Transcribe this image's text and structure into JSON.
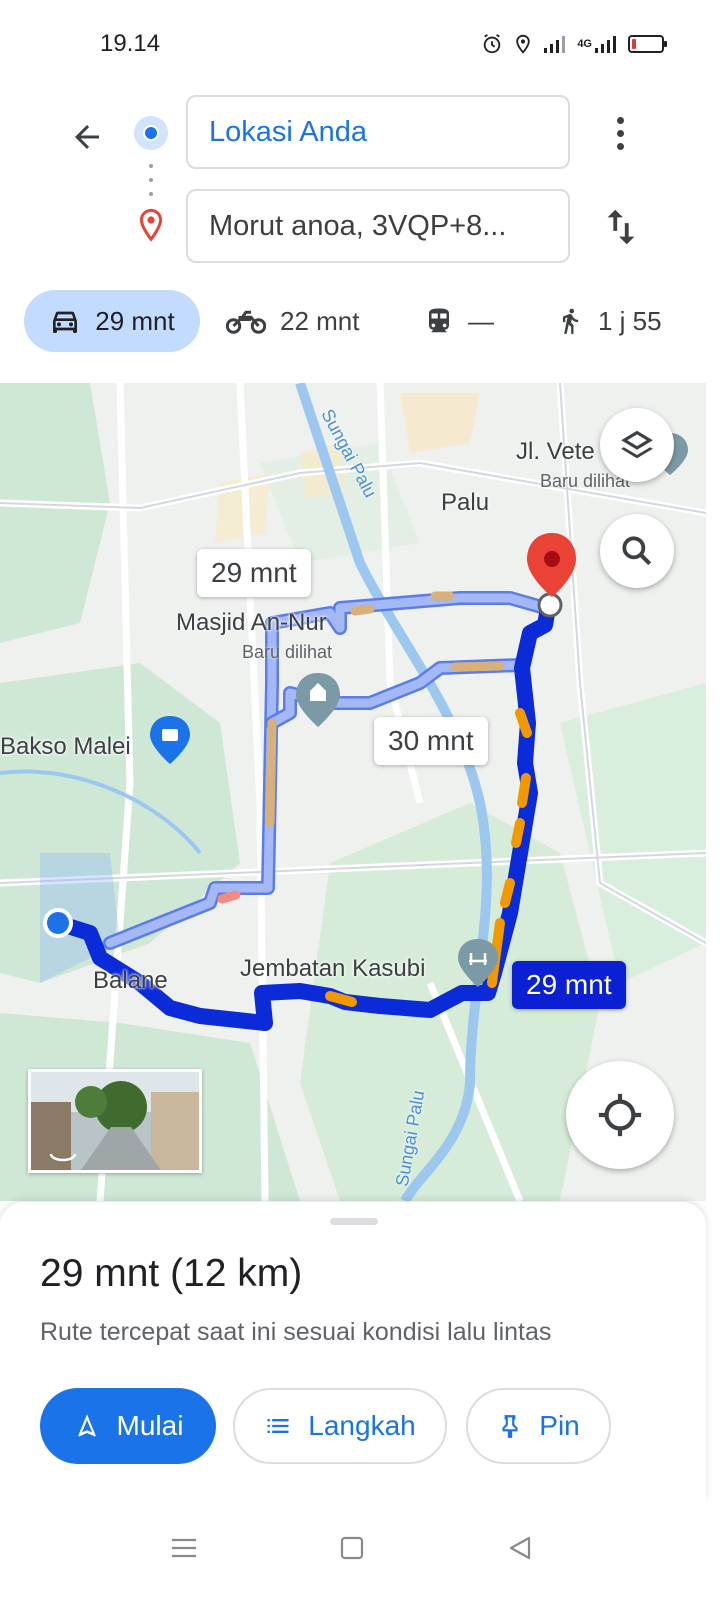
{
  "status_bar": {
    "time": "19.14",
    "network": "4G",
    "icons": [
      "alarm-icon",
      "location-icon",
      "signal-icon",
      "data-signal-icon",
      "battery-low-icon"
    ],
    "battery_color": "#e53935"
  },
  "directions": {
    "origin": "Lokasi Anda",
    "destination": "Morut anoa, 3VQP+8...",
    "origin_color": "#1a73e8",
    "destination_pin_color": "#ea4335"
  },
  "modes": [
    {
      "name": "drive",
      "icon": "car-icon",
      "label": "29 mnt",
      "selected": true
    },
    {
      "name": "motorcycle",
      "icon": "motorcycle-icon",
      "label": "22 mnt",
      "selected": false
    },
    {
      "name": "transit",
      "icon": "train-icon",
      "label": "—",
      "selected": false
    },
    {
      "name": "walk",
      "icon": "walking-icon",
      "label": "1 j 55",
      "selected": false
    }
  ],
  "map": {
    "labels": {
      "palu": "Palu",
      "jl_vete": "Jl. Vete",
      "baru_dilihat_1": "Baru dilihat",
      "masjid": "Masjid An-Nur",
      "baru_dilihat_2": "Baru dilihat",
      "bakso": "Bakso Malei",
      "balane": "Balane",
      "jembatan": "Jembatan Kasubi",
      "sungai_palu_top": "Sungai Palu",
      "sungai_palu_bottom": "Sungai Palu"
    },
    "route_bubbles": {
      "alt1": "29 mnt",
      "alt2": "30 mnt",
      "main": "29 mnt"
    },
    "route_color": "#1a3cf0",
    "alt_route_color": "#a4b8f5",
    "traffic_color": "#f29900"
  },
  "sheet": {
    "summary": "29 mnt (12 km)",
    "description": "Rute tercepat saat ini sesuai kondisi lalu lintas",
    "start_label": "Mulai",
    "steps_label": "Langkah",
    "pin_label": "Pin"
  }
}
